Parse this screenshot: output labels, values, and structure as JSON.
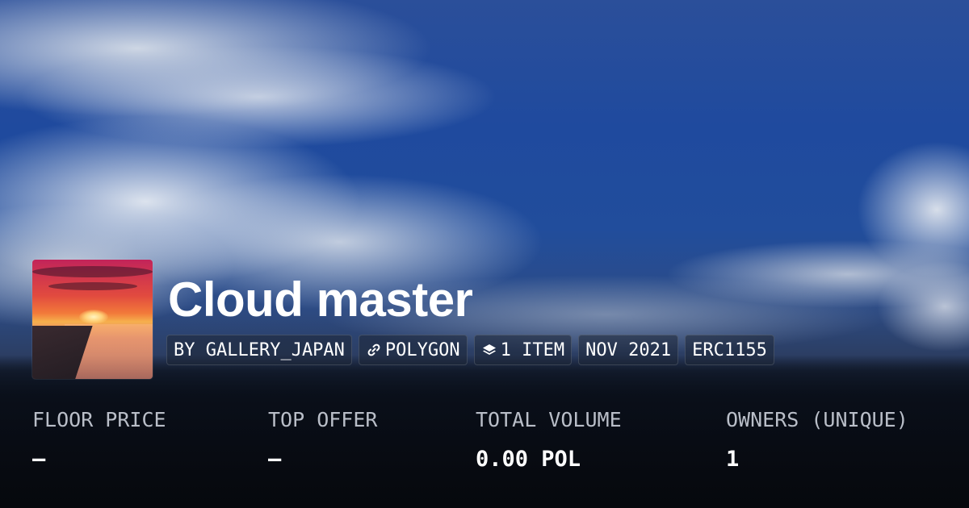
{
  "collection": {
    "title": "Cloud master",
    "tags": {
      "creator": "BY GALLERY_JAPAN",
      "chain": "POLYGON",
      "chain_icon": "link-icon",
      "items": "1 ITEM",
      "items_icon": "layers-icon",
      "date": "NOV 2021",
      "standard": "ERC1155"
    }
  },
  "stats": {
    "floor_price": {
      "label": "FLOOR PRICE",
      "value": "–"
    },
    "top_offer": {
      "label": "TOP OFFER",
      "value": "–"
    },
    "total_volume": {
      "label": "TOTAL VOLUME",
      "value": "0.00 POL"
    },
    "owners": {
      "label": "OWNERS (UNIQUE)",
      "value": "1"
    }
  },
  "colors": {
    "sky": "#214d9c",
    "text": "#ffffff",
    "label": "#b9bec8"
  }
}
